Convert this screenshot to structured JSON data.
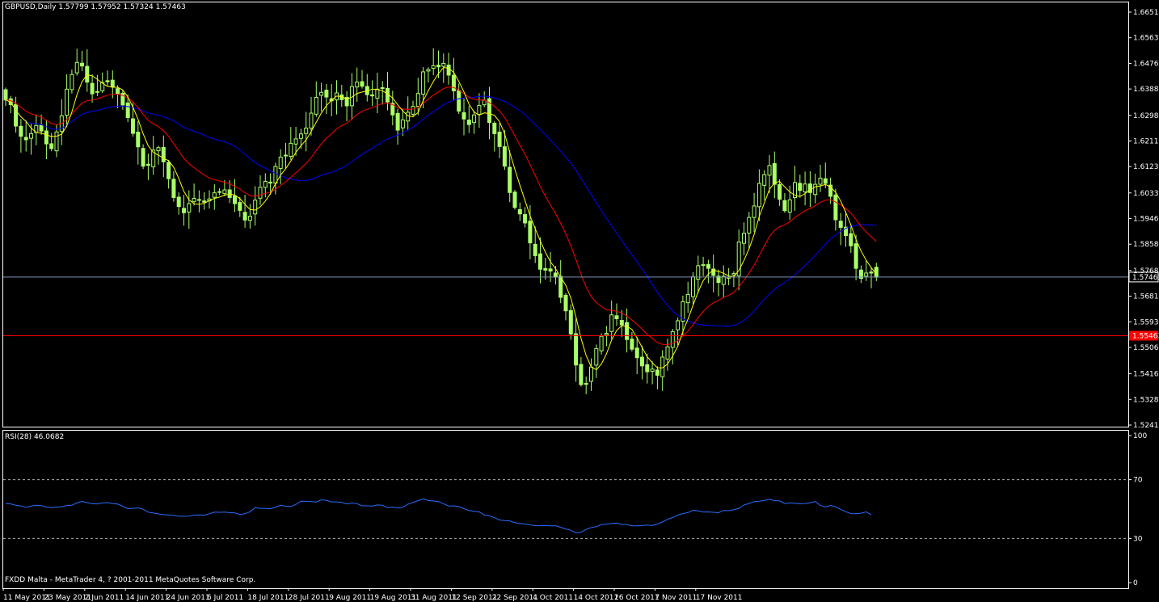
{
  "header": {
    "symbol": "GBPUSD,Daily",
    "ohlc": "1.57799 1.57952 1.57324 1.57463"
  },
  "rsi_header": "RSI(28) 46.0682",
  "footer": "FXDD Malta - MetaTrader 4, ? 2001-2011 MetaQuotes Software Corp.",
  "colors": {
    "background": "#000000",
    "frame": "#ffffff",
    "candle": "#aaff66",
    "ma_fast": "#ffff00",
    "ma_mid": "#ff0000",
    "ma_slow": "#0000ff",
    "rsi": "#2a6cff",
    "bid_line": "#7f93b8",
    "level_line": "#ff0000"
  },
  "chart_data": [
    {
      "type": "candlestick",
      "title": "GBPUSD,Daily",
      "ylim": [
        1.5241,
        1.6651
      ],
      "y_ticks": [
        "1.66510",
        "1.65635",
        "1.64760",
        "1.63885",
        "1.62985",
        "1.62110",
        "1.61235",
        "1.60335",
        "1.59460",
        "1.58585",
        "1.57685",
        "1.56810",
        "1.55935",
        "1.55060",
        "1.54160",
        "1.53285",
        "1.52410"
      ],
      "x_ticks": [
        "11 May 2011",
        "23 May 2011",
        "2 Jun 2011",
        "14 Jun 2011",
        "24 Jun 2011",
        "6 Jul 2011",
        "18 Jul 2011",
        "28 Jul 2011",
        "9 Aug 2011",
        "19 Aug 2011",
        "31 Aug 2011",
        "12 Sep 2011",
        "22 Sep 2011",
        "4 Oct 2011",
        "14 Oct 2011",
        "26 Oct 2011",
        "7 Nov 2011",
        "17 Nov 2011"
      ],
      "closes": [
        1.6351,
        1.6335,
        1.6262,
        1.6227,
        1.6215,
        1.6236,
        1.6264,
        1.6245,
        1.6201,
        1.6185,
        1.6242,
        1.6297,
        1.6388,
        1.6438,
        1.6479,
        1.6467,
        1.6412,
        1.6372,
        1.6379,
        1.6411,
        1.6413,
        1.6397,
        1.6372,
        1.6334,
        1.6291,
        1.6237,
        1.6191,
        1.6125,
        1.6128,
        1.618,
        1.6188,
        1.614,
        1.6082,
        1.6018,
        1.5987,
        1.5966,
        1.5997,
        1.6015,
        1.601,
        1.6002,
        1.6013,
        1.6034,
        1.6038,
        1.6044,
        1.6018,
        1.5997,
        1.5974,
        1.5941,
        1.5954,
        1.6009,
        1.6053,
        1.6073,
        1.6067,
        1.6124,
        1.6156,
        1.6162,
        1.6203,
        1.6218,
        1.6235,
        1.6255,
        1.6306,
        1.636,
        1.6377,
        1.6361,
        1.6348,
        1.6375,
        1.6352,
        1.6331,
        1.6397,
        1.6412,
        1.6398,
        1.6369,
        1.6365,
        1.6388,
        1.6393,
        1.6344,
        1.63,
        1.6248,
        1.6283,
        1.6309,
        1.6329,
        1.6373,
        1.6447,
        1.6455,
        1.6468,
        1.6464,
        1.6476,
        1.6436,
        1.6382,
        1.6313,
        1.6286,
        1.6267,
        1.63,
        1.6332,
        1.635,
        1.6274,
        1.6236,
        1.6192,
        1.6125,
        1.6035,
        1.5984,
        1.5962,
        1.5931,
        1.5863,
        1.5819,
        1.5773,
        1.577,
        1.5767,
        1.5746,
        1.5677,
        1.5631,
        1.5552,
        1.5446,
        1.5379,
        1.5383,
        1.5439,
        1.5502,
        1.5544,
        1.5554,
        1.5617,
        1.5604,
        1.5583,
        1.5533,
        1.55,
        1.5471,
        1.5443,
        1.5423,
        1.5432,
        1.5411,
        1.5473,
        1.5508,
        1.556,
        1.5597,
        1.5662,
        1.5687,
        1.5747,
        1.5785,
        1.5789,
        1.5776,
        1.5752,
        1.5728,
        1.5749,
        1.5746,
        1.5758,
        1.5866,
        1.5896,
        1.595,
        1.5989,
        1.6066,
        1.6096,
        1.6127,
        1.6063,
        1.6012,
        1.5973,
        1.601,
        1.6069,
        1.6042,
        1.6064,
        1.6035,
        1.6063,
        1.6084,
        1.6066,
        1.6022,
        1.5942,
        1.5916,
        1.5888,
        1.5853,
        1.5776,
        1.5742,
        1.576,
        1.576,
        1.5746
      ],
      "ma_fast_last": 1.5746,
      "ma_mid_last": 1.5919,
      "ma_slow_last": 1.5855,
      "bid": 1.57463,
      "bid_label": "1.57463",
      "level": 1.5546,
      "level_label": "1.55463"
    },
    {
      "type": "line",
      "title": "RSI(28) 46.0682",
      "ylim": [
        0,
        100
      ],
      "y_ticks": [
        "100",
        "70",
        "30",
        "0"
      ],
      "levels": [
        30,
        70
      ],
      "values": [
        53.7,
        53.5,
        52.6,
        52.1,
        51.2,
        52.1,
        52.6,
        52.3,
        51.4,
        51.0,
        51.4,
        51.6,
        52.4,
        52.6,
        54.2,
        55.2,
        54.4,
        53.6,
        53.5,
        54.2,
        54.4,
        53.7,
        53.4,
        51.9,
        50.2,
        50.5,
        50.8,
        49.9,
        47.9,
        47.3,
        46.7,
        46.2,
        46.0,
        45.7,
        45.1,
        45.1,
        45.2,
        45.9,
        46.0,
        45.9,
        46.8,
        47.9,
        47.8,
        47.9,
        47.6,
        47.4,
        46.3,
        46.8,
        48.2,
        51.0,
        50.5,
        50.5,
        50.2,
        51.3,
        52.6,
        51.9,
        51.7,
        53.2,
        55.4,
        55.3,
        55.1,
        54.8,
        56.3,
        55.9,
        54.9,
        54.9,
        54.5,
        53.5,
        54.1,
        53.7,
        52.2,
        52.2,
        52.1,
        52.8,
        52.6,
        51.0,
        51.4,
        50.7,
        51.2,
        53.3,
        54.6,
        55.7,
        56.9,
        55.8,
        55.5,
        55.1,
        53.6,
        52.1,
        52.2,
        51.7,
        50.3,
        49.0,
        48.5,
        48.1,
        46.0,
        45.4,
        44.1,
        42.6,
        42.2,
        42.0,
        40.7,
        40.2,
        39.9,
        39.3,
        38.7,
        38.7,
        38.9,
        38.6,
        38.7,
        37.6,
        36.5,
        35.6,
        33.8,
        34.2,
        36.2,
        37.5,
        38.0,
        39.4,
        39.8,
        40.3,
        40.5,
        39.5,
        39.5,
        38.6,
        38.6,
        38.8,
        39.2,
        38.8,
        39.9,
        41.2,
        43.0,
        44.3,
        45.9,
        46.9,
        47.6,
        49.3,
        48.8,
        48.0,
        48.1,
        47.8,
        47.5,
        49.1,
        48.9,
        49.6,
        50.4,
        52.8,
        53.8,
        55.1,
        55.4,
        55.8,
        56.7,
        55.7,
        55.6,
        53.8,
        54.2,
        53.9,
        53.6,
        53.8,
        54.3,
        55.1,
        52.4,
        51.5,
        52.5,
        51.6,
        49.8,
        48.2,
        46.9,
        46.8,
        47.2,
        48.1,
        46.1
      ]
    }
  ]
}
